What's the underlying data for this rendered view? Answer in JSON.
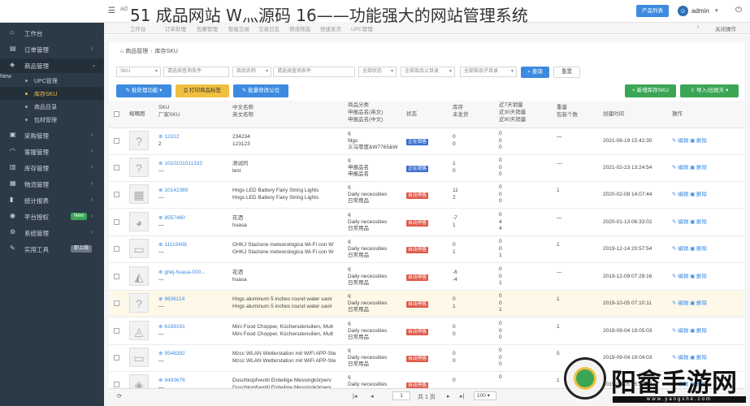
{
  "headline": "51 成品网站 W灬源码 16——功能强大的网站管理系统",
  "topbar": {
    "app_title": "ad",
    "product_button": "产品列表",
    "user_name": "admin"
  },
  "sidebar": {
    "items": [
      {
        "icon": "home-icon",
        "glyph": "⌂",
        "label": "工作台",
        "arrow": ""
      },
      {
        "icon": "cart-icon",
        "glyph": "▤",
        "label": "订单管理",
        "arrow": "›"
      },
      {
        "icon": "box-icon",
        "glyph": "◈",
        "label": "商品管理",
        "arrow": "⌄"
      },
      {
        "icon": "purchase-icon",
        "glyph": "▣",
        "label": "采购管理",
        "arrow": "›"
      },
      {
        "icon": "headset-icon",
        "glyph": "◠",
        "label": "客服管理",
        "arrow": "›"
      },
      {
        "icon": "warehouse-icon",
        "glyph": "▥",
        "label": "库存管理",
        "arrow": "›"
      },
      {
        "icon": "truck-icon",
        "glyph": "▦",
        "label": "物流管理",
        "arrow": "›"
      },
      {
        "icon": "chart-icon",
        "glyph": "▮",
        "label": "统计报表",
        "arrow": "›"
      },
      {
        "icon": "auth-icon",
        "glyph": "◉",
        "label": "平台授权",
        "arrow": "›",
        "badge": "New"
      },
      {
        "icon": "settings-icon",
        "glyph": "⚙",
        "label": "系统管理",
        "arrow": "›"
      },
      {
        "icon": "tools-icon",
        "glyph": "✎",
        "label": "实用工具",
        "arrow": "",
        "badge": "即上线"
      }
    ],
    "sub_items": [
      {
        "label": "UPC管理",
        "badge": "New",
        "active": false
      },
      {
        "label": "库存SKU",
        "active": true
      },
      {
        "label": "商品目录",
        "active": false
      },
      {
        "label": "包材管理",
        "active": false
      }
    ]
  },
  "tabs": [
    "工作台",
    "订单处理",
    "包裹管理",
    "智能交易",
    "交易日志",
    "快递筛选",
    "快速发货",
    "UPC管理"
  ],
  "tab_controls": {
    "close_all": "关闭操作"
  },
  "breadcrumb": {
    "section": "商品管理",
    "page": "库存SKU"
  },
  "filters": {
    "sku_select": "SKU",
    "sku_placeholder": "请选择查询条件",
    "name_select": "商品名称",
    "name_placeholder": "请选择查询条件",
    "status": "全部状态",
    "parent_category": "全部商品父目录",
    "child_category": "全部商品子目录",
    "search_button": "查询",
    "reset_button": "重置"
  },
  "actions": {
    "batch": "批处理功能",
    "print": "打印商品标签",
    "batch_edit": "批量修改公位",
    "new_sku": "新增库存SKU",
    "import": "导入/出规天"
  },
  "table": {
    "headers": {
      "thumb": "缩略图",
      "sku": [
        "SKU",
        "厂家SKU"
      ],
      "name": [
        "中文名称",
        "英文名称"
      ],
      "category": [
        "商品分类",
        "申报品名(英文)",
        "申报品名(中文)"
      ],
      "status": "状态",
      "stock": [
        "库存",
        "未发货"
      ],
      "sales": [
        "近7天销量",
        "近30天销量",
        "近90天销量"
      ],
      "weight": [
        "重量",
        "包装个数"
      ],
      "created": "创建时间",
      "ops": "操作"
    },
    "edit_label": "编辑",
    "delete_label": "删除",
    "rows": [
      {
        "thumb": "?",
        "sku": "12312",
        "factory": "2",
        "cn": "234234",
        "en": "123123",
        "cat": [
          "q",
          "fdgs",
          "义乌零度&W7765&W"
        ],
        "status": "正在销售",
        "status_type": "on",
        "stock": [
          "0",
          "0"
        ],
        "sales": [
          "0",
          "0",
          "0"
        ],
        "weight": [
          "—",
          ""
        ],
        "created": "2021-08-19 15:42:30",
        "hl": false
      },
      {
        "thumb": "?",
        "sku": "1010101011333",
        "factory": "—",
        "cn": "测试的",
        "en": "test",
        "cat": [
          "q",
          "申报品名",
          "申报品名"
        ],
        "status": "正在销售",
        "status_type": "on",
        "stock": [
          "1",
          "0"
        ],
        "sales": [
          "0",
          "0",
          "0"
        ],
        "weight": [
          "—",
          ""
        ],
        "created": "2021-02-23 13:24:54",
        "hl": false
      },
      {
        "thumb": "▦",
        "sku": "10142389",
        "factory": "—",
        "cn": "Hngs LED Battery Fairy String Lights",
        "en": "Hngs LED Battery Fairy String Lights",
        "cat": [
          "q",
          "Daily necessities",
          "日常用品"
        ],
        "status": "自动停售",
        "status_type": "auto",
        "stock": [
          "11",
          "2"
        ],
        "sales": [
          "0",
          "0",
          "0"
        ],
        "weight": [
          "1",
          ""
        ],
        "created": "2020-02-08 14:07:44",
        "hl": false
      },
      {
        "thumb": "◕",
        "sku": "8557460",
        "factory": "—",
        "cn": "花洒",
        "en": "huasa",
        "cat": [
          "q",
          "Daily necessities",
          "日常用品"
        ],
        "status": "自动停售",
        "status_type": "auto",
        "stock": [
          "-7",
          "1"
        ],
        "sales": [
          "0",
          "4",
          "4"
        ],
        "weight": [
          "—",
          ""
        ],
        "created": "2020-01-13 06:33:02",
        "hl": false
      },
      {
        "thumb": "▭",
        "sku": "11119408",
        "factory": "—",
        "cn": "GHKJ Stazione meteorologica Wi-Fi con W",
        "en": "GHKJ Stazione meteorologica Wi-Fi con W",
        "cat": [
          "q",
          "Daily necessities",
          "日常用品"
        ],
        "status": "自动停售",
        "status_type": "auto",
        "stock": [
          "0",
          "1"
        ],
        "sales": [
          "0",
          "0",
          "1"
        ],
        "weight": [
          "1",
          ""
        ],
        "created": "2019-12-14 20:57:54",
        "hl": false
      },
      {
        "thumb": "◭",
        "sku": "ghkj-huasa-000...",
        "factory": "—",
        "cn": "花洒",
        "en": "huasa",
        "cat": [
          "q",
          "Daily necessities",
          "日常用品"
        ],
        "status": "自动停售",
        "status_type": "auto",
        "stock": [
          "-6",
          "-4"
        ],
        "sales": [
          "0",
          "0",
          "1"
        ],
        "weight": [
          "—",
          ""
        ],
        "created": "2019-12-09 07:29:16",
        "hl": false
      },
      {
        "thumb": "?",
        "sku": "9636114",
        "factory": "—",
        "cn": "Hngs aluminum 5 inches round water savir",
        "en": "Hngs aluminum 5 inches round water savir",
        "cat": [
          "q",
          "Daily necessities",
          "日常用品"
        ],
        "status": "自动停售",
        "status_type": "auto",
        "stock": [
          "0",
          "1"
        ],
        "sales": [
          "0",
          "0",
          "1"
        ],
        "weight": [
          "1",
          ""
        ],
        "created": "2019-10-05 07:10:11",
        "hl": true
      },
      {
        "thumb": "◬",
        "sku": "6169161",
        "factory": "—",
        "cn": "Mini Food Chopper, Küchenutensilien, Mult",
        "en": "Mini Food Chopper, Küchenutensilien, Mult",
        "cat": [
          "q",
          "Daily necessities",
          "日常用品"
        ],
        "status": "自动停售",
        "status_type": "auto",
        "stock": [
          "0",
          "0"
        ],
        "sales": [
          "0",
          "0",
          "0"
        ],
        "weight": [
          "1",
          ""
        ],
        "created": "2019-09-04 19:05:03",
        "hl": false
      },
      {
        "thumb": "▭",
        "sku": "9548392",
        "factory": "—",
        "cn": "Mzcc WLAN Wetterstation mit WiFi APP-Ste",
        "en": "Mzcc WLAN Wetterstation mit WiFi APP-Ste",
        "cat": [
          "q",
          "Daily necessities",
          "日常用品"
        ],
        "status": "自动停售",
        "status_type": "auto",
        "stock": [
          "0",
          "0"
        ],
        "sales": [
          "0",
          "0",
          "0"
        ],
        "weight": [
          "5",
          ""
        ],
        "created": "2019-09-04 19:04:03",
        "hl": false
      },
      {
        "thumb": "◈",
        "sku": "9493676",
        "factory": "—",
        "cn": "Duschkopfventil Einteilige Messingkörperv",
        "en": "Duschkopfventil Einteilige Messingkörperv",
        "cat": [
          "q",
          "Daily necessities",
          ""
        ],
        "status": "自动停售",
        "status_type": "auto",
        "stock": [
          "0",
          ""
        ],
        "sales": [
          "0",
          "",
          ""
        ],
        "weight": [
          "1",
          ""
        ],
        "created": "2019-08-05 15:28:57",
        "hl": false
      }
    ]
  },
  "pagination": {
    "page": "1",
    "total_text": "共 1 页",
    "page_size": "100"
  },
  "watermark": {
    "text": "阳畲手游网",
    "url": "www.yangshe.com"
  },
  "colors": {
    "primary": "#3d8be0",
    "sidebar": "#2b3a46",
    "success": "#3aa655",
    "warning": "#f0c040",
    "danger": "#e05a4a"
  }
}
